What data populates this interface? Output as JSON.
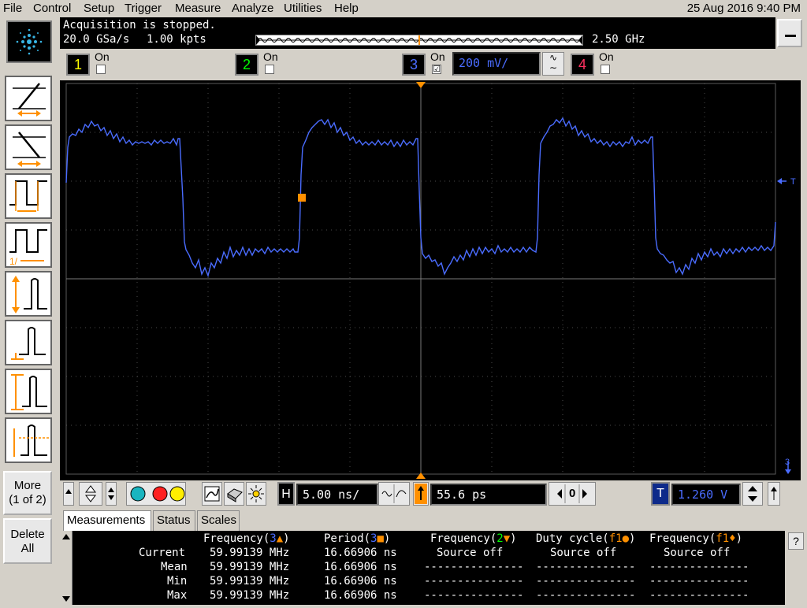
{
  "menu": {
    "items": [
      "File",
      "Control",
      "Setup",
      "Trigger",
      "Measure",
      "Analyze",
      "Utilities",
      "Help"
    ],
    "datetime": "25 Aug 2016  9:40 PM"
  },
  "acquisition": {
    "status": "Acquisition is stopped.",
    "sample_rate": "20.0 GSa/s",
    "memory_depth": "1.00 kpts",
    "bandwidth": "2.50 GHz"
  },
  "channels": [
    {
      "number": "1",
      "on_label": "On",
      "checked": false,
      "color": "#ffff00"
    },
    {
      "number": "2",
      "on_label": "On",
      "checked": false,
      "color": "#00ff00"
    },
    {
      "number": "3",
      "on_label": "On",
      "checked": true,
      "color": "#4a6cff",
      "scale": "200 mV/"
    },
    {
      "number": "4",
      "on_label": "On",
      "checked": false,
      "color": "#ff3060"
    }
  ],
  "channel3_check": "☑",
  "coupling_glyphs": [
    "∿",
    "∼"
  ],
  "left_toolbar": {
    "more_label_line1": "More",
    "more_label_line2": "(1 of 2)",
    "delete_label_line1": "Delete",
    "delete_label_line2": "All"
  },
  "markers": {
    "trigger_level": "T",
    "channel_ground": "3"
  },
  "horizontal": {
    "h_label": "H",
    "timebase": "5.00 ns/",
    "position": "55.6 ps",
    "zero_label": "0"
  },
  "trigger": {
    "t_label": "T",
    "level": "1.260 V"
  },
  "tabs": [
    "Measurements",
    "Status",
    "Scales"
  ],
  "measurements": {
    "headers": [
      {
        "pre": "Frequency(",
        "src": "3",
        "mark": "▲",
        "post": ")",
        "src_color": "#4a6cff",
        "mark_color": "#ff9000"
      },
      {
        "pre": "Period(",
        "src": "3",
        "mark": "■",
        "post": ")",
        "src_color": "#4a6cff",
        "mark_color": "#ff9000"
      },
      {
        "pre": "Frequency(",
        "src": "2",
        "mark": "▼",
        "post": ")",
        "src_color": "#00ff00",
        "mark_color": "#ff9000"
      },
      {
        "pre": "Duty cycle(",
        "src": "f1",
        "mark": "●",
        "post": ")",
        "src_color": "#ff9000",
        "mark_color": "#ff9000"
      },
      {
        "pre": "Frequency(",
        "src": "f1",
        "mark": "♦",
        "post": ")",
        "src_color": "#ff9000",
        "mark_color": "#ff9000"
      }
    ],
    "rows": [
      {
        "label": "Current",
        "values": [
          "59.99139 MHz",
          "16.66906 ns",
          "Source off",
          "Source off",
          "Source off"
        ]
      },
      {
        "label": "Mean",
        "values": [
          "59.99139 MHz",
          "16.66906 ns",
          "---------------",
          "---------------",
          "---------------"
        ]
      },
      {
        "label": "Min",
        "values": [
          "59.99139 MHz",
          "16.66906 ns",
          "---------------",
          "---------------",
          "---------------"
        ]
      },
      {
        "label": "Max",
        "values": [
          "59.99139 MHz",
          "16.66906 ns",
          "---------------",
          "---------------",
          "---------------"
        ]
      }
    ],
    "help": "?"
  }
}
